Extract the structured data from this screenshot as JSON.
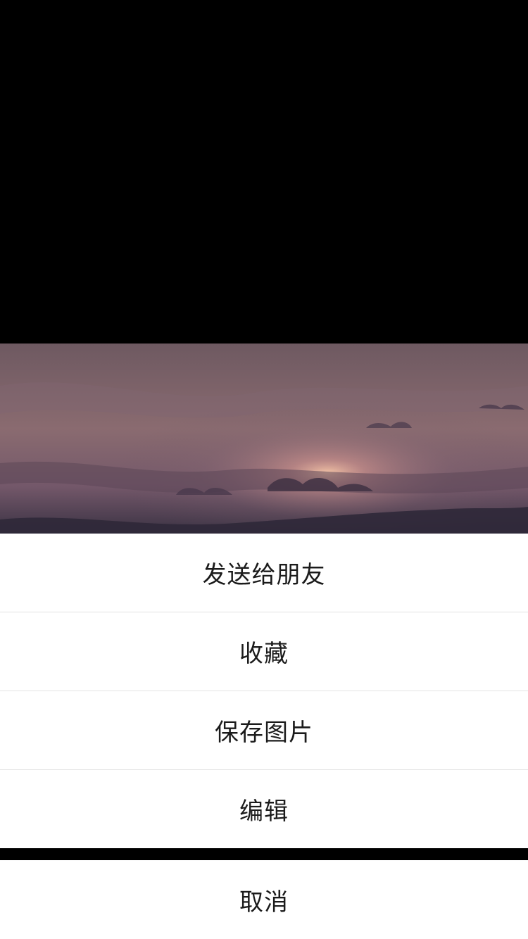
{
  "action_sheet": {
    "items": [
      {
        "label": "发送给朋友"
      },
      {
        "label": "收藏"
      },
      {
        "label": "保存图片"
      },
      {
        "label": "编辑"
      }
    ],
    "cancel_label": "取消"
  },
  "colors": {
    "viewer_background": "#000000",
    "sheet_background": "#ffffff",
    "sheet_text": "#1b1b1b",
    "divider": "#e3e3e3"
  }
}
